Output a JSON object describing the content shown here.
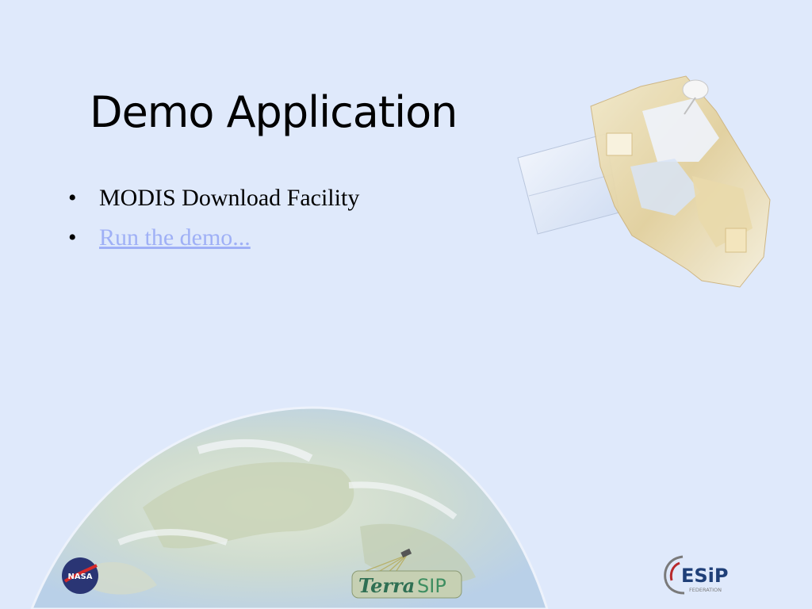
{
  "slide": {
    "title": "Demo Application",
    "bullet_symbol": "•",
    "bullets": [
      {
        "text": "MODIS Download Facility"
      },
      {
        "text": "Run the demo..."
      }
    ]
  },
  "logos": {
    "nasa_text": "NASA",
    "terrasip_text_1": "Terra",
    "terrasip_text_2": "SIP",
    "esip_text": "ESiP",
    "esip_subtext": "FEDERATION"
  },
  "icons": {
    "satellite": "satellite-illustration-icon",
    "globe": "earth-globe-icon",
    "nasa": "nasa-logo-icon",
    "terrasip": "terrasip-logo-icon",
    "esip": "esip-federation-logo-icon"
  },
  "colors": {
    "background": "#dfe9fb",
    "link": "#9fb0f6",
    "text": "#000000"
  }
}
